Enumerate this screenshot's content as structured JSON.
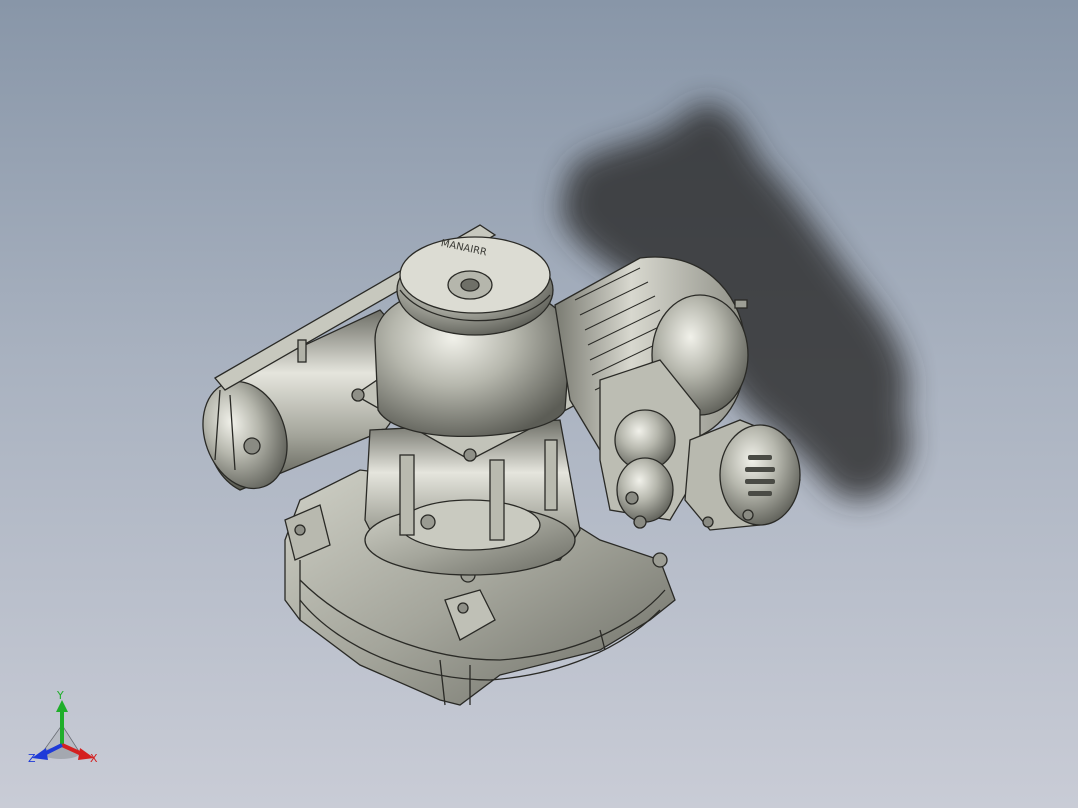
{
  "viewport": {
    "background_top": "#8896a8",
    "background_bottom": "#c9ccd6",
    "model_color": "#a7a89e",
    "edge_color": "#2a2a26",
    "shadow_color": "#2b2b2b"
  },
  "model": {
    "emboss_text": "MANAIRR"
  },
  "triad": {
    "x_label": "X",
    "y_label": "Y",
    "z_label": "Z",
    "x_color": "#d42020",
    "y_color": "#1fae2a",
    "z_color": "#1f3bd8"
  }
}
